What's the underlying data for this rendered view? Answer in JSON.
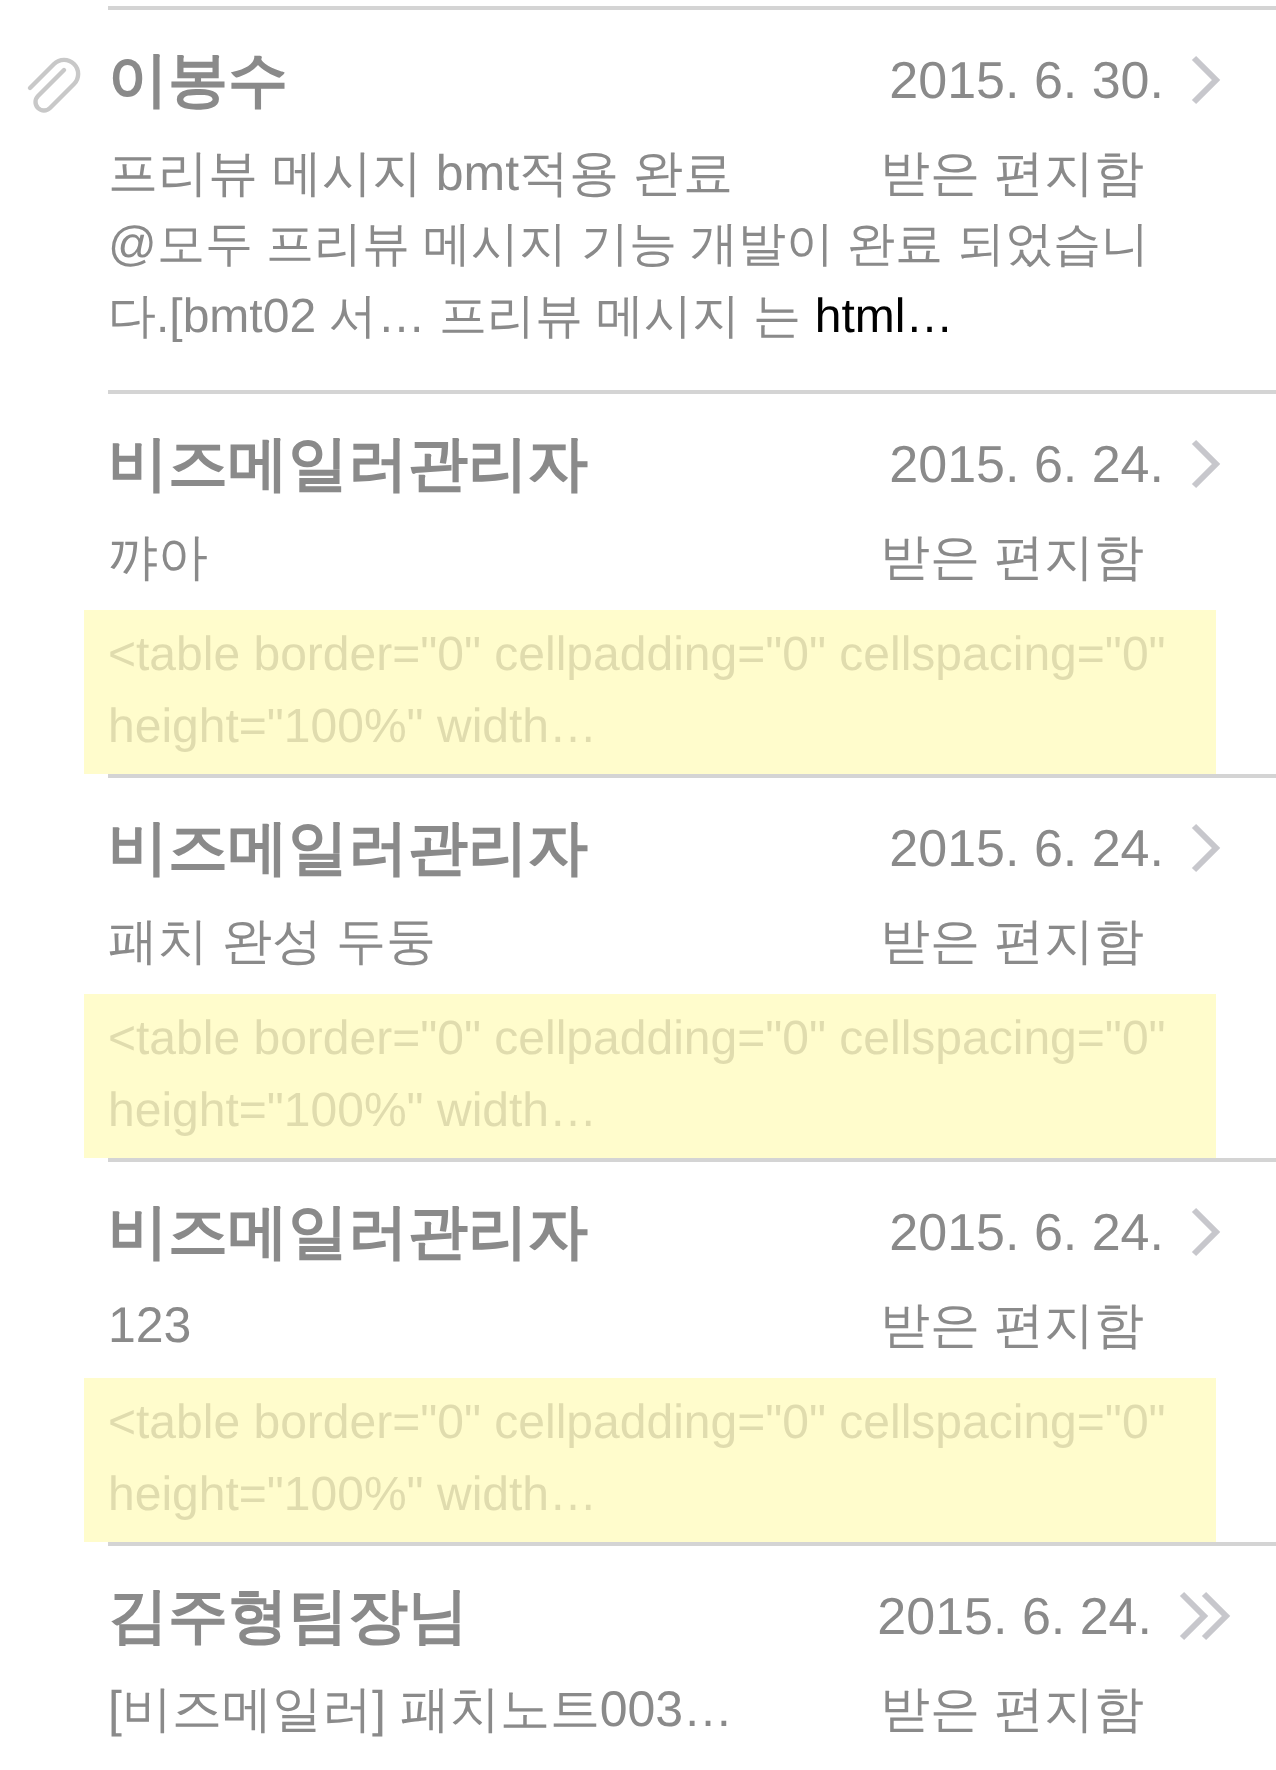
{
  "messages": [
    {
      "sender": "이봉수",
      "date": "2015. 6. 30.",
      "attachment": true,
      "kind": "chevron",
      "subject": "프리뷰 메시지 bmt적용 완료",
      "folder": "받은 편지함",
      "highlighted": false,
      "preview": [
        {
          "text": "@모두 프리뷰 메시지 기능 개발이 완료 되었습니다.[bmt02 서… 프리뷰 메시지 는 ",
          "dark": false
        },
        {
          "text": "html…",
          "dark": true
        }
      ]
    },
    {
      "sender": "비즈메일러관리자",
      "date": "2015. 6. 24.",
      "attachment": false,
      "kind": "chevron",
      "subject": "꺄아",
      "folder": "받은 편지함",
      "highlighted": true,
      "preview": [
        {
          "text": "<table border=\"0\" cellpadding=\"0\" cellspacing=\"0\" height=\"100%\" width…",
          "dark": false
        }
      ]
    },
    {
      "sender": "비즈메일러관리자",
      "date": "2015. 6. 24.",
      "attachment": false,
      "kind": "chevron",
      "subject": "패치 완성 두둥",
      "folder": "받은 편지함",
      "highlighted": true,
      "preview": [
        {
          "text": "<table border=\"0\" cellpadding=\"0\" cellspacing=\"0\" height=\"100%\" width…",
          "dark": false
        }
      ]
    },
    {
      "sender": "비즈메일러관리자",
      "date": "2015. 6. 24.",
      "attachment": false,
      "kind": "chevron",
      "subject": "123",
      "folder": "받은 편지함",
      "highlighted": true,
      "preview": [
        {
          "text": "<table border=\"0\" cellpadding=\"0\" cellspacing=\"0\" height=\"100%\" width…",
          "dark": false
        }
      ]
    },
    {
      "sender": "김주형팀장님",
      "date": "2015. 6. 24.",
      "attachment": false,
      "kind": "double-chevron",
      "subject": "[비즈메일러] 패치노트003…",
      "folder": "받은 편지함",
      "highlighted": false
    }
  ]
}
